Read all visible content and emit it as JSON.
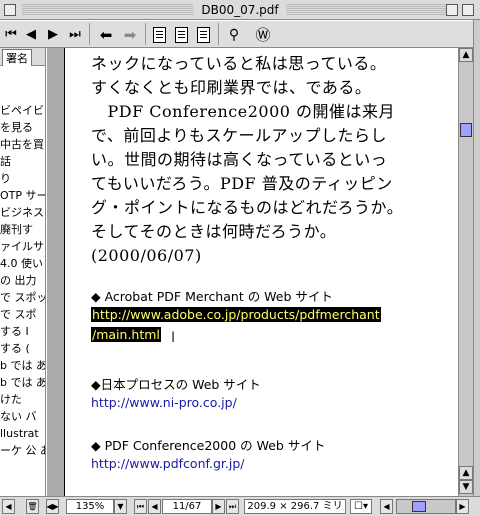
{
  "window": {
    "title": "DB00_07.pdf"
  },
  "toolbar": {
    "buttons": [
      {
        "name": "first-page-button",
        "glyph": "⏮"
      },
      {
        "name": "prev-page-button",
        "glyph": "◀"
      },
      {
        "name": "next-page-button",
        "glyph": "▶"
      },
      {
        "name": "last-page-button",
        "glyph": "⏭"
      },
      {
        "name": "go-back-button",
        "glyph": "🡸"
      },
      {
        "name": "go-forward-button",
        "glyph": "🡺"
      }
    ],
    "find_glyph": "🔭",
    "web_glyph": "Ⓦ"
  },
  "sidebar": {
    "tab_label": "署名",
    "items": [
      "",
      "",
      "ビペイビ",
      "を見る",
      "中古を買",
      "話",
      "り",
      "OTP サー",
      "ビジネス",
      "廃刊す",
      "ァイルサ",
      "4.0 使い",
      "の 出力",
      "で スポッ",
      "で スポ",
      "する I",
      "する (",
      "b では あ",
      "b では あ",
      "けた",
      "ない バ",
      "llustrat",
      "ーケ 公 あ"
    ]
  },
  "document": {
    "paragraph_lines": [
      "ネックになっていると私は思っている。",
      "すくなくとも印刷業界では、である。",
      "　PDF Conference2000 の開催は来月",
      "で、前回よりもスケールアップしたらし",
      "い。世間の期待は高くなっているといっ",
      "てもいいだろう。PDF 普及のティッピン",
      "グ・ポイントになるものはどれだろうか。",
      "そしてそのときは何時だろうか。",
      "(2000/06/07)"
    ],
    "sections": [
      {
        "heading": "◆ Acrobat PDF Merchant の Web サイト",
        "link_lines": [
          "http://www.adobe.co.jp/products/pdfmerchant",
          "/main.html"
        ],
        "highlighted": true
      },
      {
        "heading": "◆日本プロセスの Web サイト",
        "link_lines": [
          "http://www.ni-pro.co.jp/"
        ],
        "highlighted": false
      },
      {
        "heading": "◆ PDF Conference2000 の Web サイト",
        "link_lines": [
          "http://www.pdfconf.gr.jp/"
        ],
        "highlighted": false
      }
    ]
  },
  "statusbar": {
    "zoom": "135%",
    "page": "11/67",
    "page_size": "209.9 × 296.7 ミリ"
  },
  "colors": {
    "link": "#1a1aa6",
    "highlight_bg": "#000000",
    "highlight_fg": "#ffff66",
    "scroll_thumb": "#9fa0ff"
  }
}
